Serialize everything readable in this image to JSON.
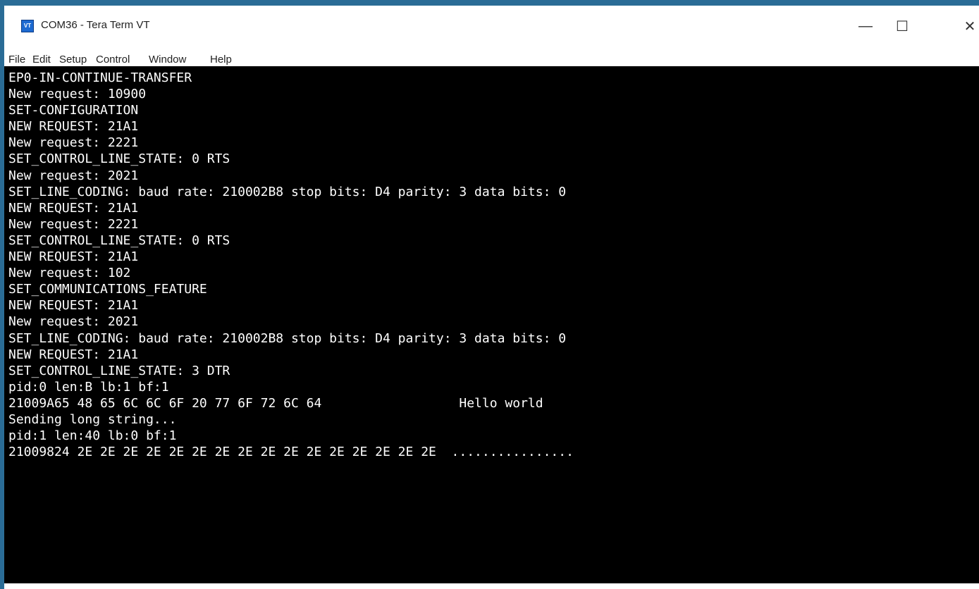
{
  "window": {
    "title": "COM36 - Tera Term VT",
    "icon_label": "VT",
    "controls": {
      "minimize": "—",
      "maximize": "☐",
      "close": "✕"
    }
  },
  "menu": [
    "File",
    "Edit",
    "Setup",
    "Control",
    "Window",
    "Help"
  ],
  "terminal": {
    "lines": [
      "EP0-IN-CONTINUE-TRANSFER",
      "New request: 10900",
      "SET-CONFIGURATION",
      "NEW REQUEST: 21A1",
      "New request: 2221",
      "SET_CONTROL_LINE_STATE: 0 RTS",
      "New request: 2021",
      "SET_LINE_CODING: baud rate: 210002B8 stop bits: D4 parity: 3 data bits: 0",
      "NEW REQUEST: 21A1",
      "New request: 2221",
      "SET_CONTROL_LINE_STATE: 0 RTS",
      "NEW REQUEST: 21A1",
      "New request: 102",
      "SET_COMMUNICATIONS_FEATURE",
      "NEW REQUEST: 21A1",
      "New request: 2021",
      "SET_LINE_CODING: baud rate: 210002B8 stop bits: D4 parity: 3 data bits: 0",
      "NEW REQUEST: 21A1",
      "SET_CONTROL_LINE_STATE: 3 DTR",
      "pid:0 len:B lb:1 bf:1",
      "21009A65 48 65 6C 6C 6F 20 77 6F 72 6C 64                  Hello world",
      "Sending long string...",
      "pid:1 len:40 lb:0 bf:1",
      "21009824 2E 2E 2E 2E 2E 2E 2E 2E 2E 2E 2E 2E 2E 2E 2E 2E  ................"
    ]
  }
}
